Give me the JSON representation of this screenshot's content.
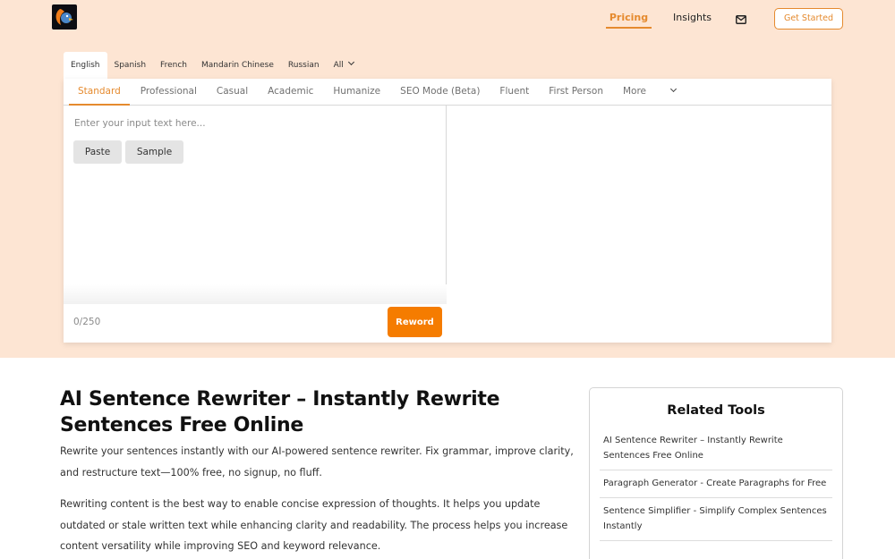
{
  "header": {
    "logo_icon": "parrot-logo-icon",
    "nav": {
      "pricing": "Pricing",
      "insights": "Insights",
      "mail_icon": "mail-icon"
    },
    "get_started": "Get Started"
  },
  "languages": {
    "items": [
      "English",
      "Spanish",
      "French",
      "Mandarin Chinese",
      "Russian",
      "All"
    ],
    "selected": "English"
  },
  "modes": {
    "items": [
      "Standard",
      "Professional",
      "Casual",
      "Academic",
      "Humanize",
      "SEO Mode (Beta)",
      "Fluent",
      "First Person",
      "More"
    ],
    "selected": "Standard"
  },
  "editor": {
    "placeholder": "Enter your input text here...",
    "paste": "Paste",
    "sample": "Sample",
    "counter": "0/250",
    "reword": "Reword"
  },
  "article": {
    "title": "AI Sentence Rewriter – Instantly Rewrite Sentences Free Online",
    "intro": "Rewrite your sentences instantly with our AI-powered sentence rewriter. Fix grammar, improve clarity, and restructure text—100% free, no signup, no fluff.",
    "paragraph": "Rewriting content is the best way to enable concise expression of thoughts. It helps you update outdated or stale written text while enhancing clarity and readability. The process helps you increase content versatility while improving SEO and keyword relevance."
  },
  "related": {
    "heading": "Related Tools",
    "items": [
      "AI Sentence Rewriter – Instantly Rewrite Sentences Free Online",
      "Paragraph Generator - Create Paragraphs for Free",
      "Sentence Simplifier - Simplify Complex Sentences Instantly"
    ]
  },
  "colors": {
    "accent": "#e58a2e",
    "reword_button": "#f57c00",
    "hero_background": "#fde5d3"
  }
}
